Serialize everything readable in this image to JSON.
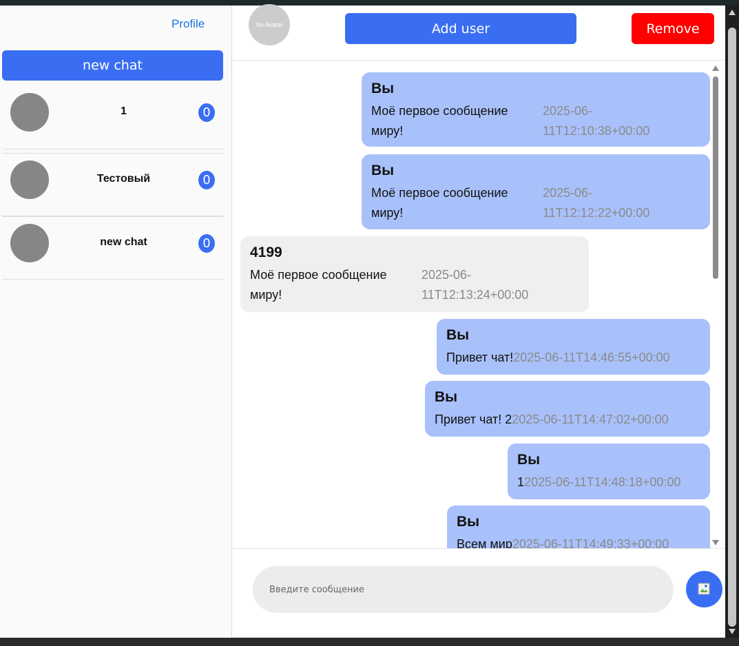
{
  "sidebar": {
    "profile_label": "Profile",
    "new_chat_label": "new chat",
    "chats": [
      {
        "name": "1",
        "unread": "0"
      },
      {
        "name": "Тестовый",
        "unread": "0"
      },
      {
        "name": "new chat",
        "unread": "0"
      }
    ]
  },
  "header": {
    "avatar_text": "No Avatar",
    "add_user_label": "Add user",
    "remove_label": "Remove"
  },
  "messages": [
    {
      "author": "Вы",
      "text": "Моё первое сообщение миру!",
      "time": "2025-06-11T12:10:38+00:00",
      "mine": true
    },
    {
      "author": "Вы",
      "text": "Моё первое сообщение миру!",
      "time": "2025-06-11T12:12:22+00:00",
      "mine": true
    },
    {
      "author": "4199",
      "text": "Моё первое сообщение миру!",
      "time": "2025-06-11T12:13:24+00:00",
      "mine": false
    },
    {
      "author": "Вы",
      "text": "Привет чат!",
      "time": "2025-06-11T14:46:55+00:00",
      "mine": true
    },
    {
      "author": "Вы",
      "text": "Привет чат! 2",
      "time": "2025-06-11T14:47:02+00:00",
      "mine": true
    },
    {
      "author": "Вы",
      "text": "1",
      "time": "2025-06-11T14:48:18+00:00",
      "mine": true
    },
    {
      "author": "Вы",
      "text": "Всем мир",
      "time": "2025-06-11T14:49:33+00:00",
      "mine": true
    }
  ],
  "composer": {
    "placeholder": "Введите сообщение"
  },
  "colors": {
    "accent": "#3a6ef2",
    "danger": "#ff0000",
    "bubble_mine": "#a9c1fb",
    "bubble_theirs": "#efefef"
  }
}
